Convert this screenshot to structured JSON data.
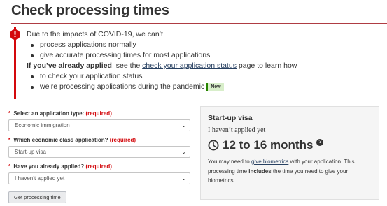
{
  "page": {
    "title": "Check processing times"
  },
  "alert": {
    "intro": "Due to the impacts of COVID-19, we can’t",
    "bullets1": [
      "process applications normally",
      "give accurate processing times for most applications"
    ],
    "applied_bold": "If you’ve already applied",
    "applied_pre": ", see the ",
    "applied_link": "check your application status",
    "applied_post": " page to learn how",
    "bullets2": [
      "to check your application status",
      "we’re processing applications during the pandemic"
    ],
    "new_badge": "New"
  },
  "form": {
    "fields": [
      {
        "label": "Select an application type:",
        "required": "(required)",
        "value": "Economic immigration"
      },
      {
        "label": "Which economic class application?",
        "required": "(required)",
        "value": "Start-up visa"
      },
      {
        "label": "Have you already applied?",
        "required": "(required)",
        "value": "I haven’t applied yet"
      }
    ],
    "submit_label": "Get processing time"
  },
  "result": {
    "title": "Start-up visa",
    "status": "I haven’t applied yet",
    "time": "12 to 16 months",
    "help_glyph": "?",
    "note_pre": "You may need to ",
    "note_link": "give biometrics",
    "note_mid": " with your application. This processing time ",
    "note_bold": "includes",
    "note_post": " the time you need to give your biometrics."
  },
  "icons": {
    "alert": "exclamation-circle-icon",
    "clock": "clock-icon",
    "help": "question-circle-icon",
    "chevron": "chevron-down-icon"
  },
  "colors": {
    "title_rule": "#af3c43",
    "alert_red": "#d3080c",
    "required_red": "#d3080c",
    "link": "#284162",
    "new_badge_bg": "#d8eeca",
    "result_bg": "#f5f5f5"
  }
}
